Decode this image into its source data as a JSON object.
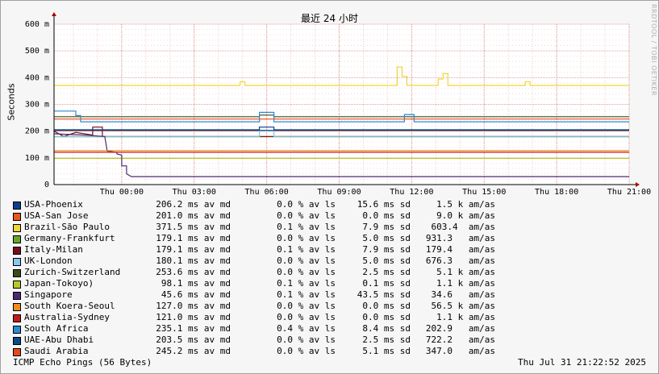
{
  "chart_data": {
    "type": "line",
    "title": "最近 24 小时",
    "ylabel": "Seconds",
    "watermark": "RRDTOOL / TOBI OETIKER",
    "ylim": [
      0,
      600
    ],
    "y_ticks": [
      {
        "v": 0,
        "label": "0"
      },
      {
        "v": 100,
        "label": "100 m"
      },
      {
        "v": 200,
        "label": "200 m"
      },
      {
        "v": 300,
        "label": "300 m"
      },
      {
        "v": 400,
        "label": "400 m"
      },
      {
        "v": 500,
        "label": "500 m"
      },
      {
        "v": 600,
        "label": "600 m"
      }
    ],
    "x_ticks": [
      "Thu 00:00",
      "Thu 03:00",
      "Thu 06:00",
      "Thu 09:00",
      "Thu 12:00",
      "Thu 15:00",
      "Thu 18:00",
      "Thu 21:00"
    ],
    "x_range_hours": [
      -2.8,
      21.0
    ],
    "series": [
      {
        "name": "USA-Phoenix",
        "color": "#0b3e8c",
        "avg": "206.2 ms av md",
        "loss": "0.0 % av ls",
        "sd": "15.6 ms sd",
        "am": "1.5 k am/as",
        "values": [
          [
            -2.8,
            205
          ],
          [
            -0.5,
            205
          ],
          [
            -0.5,
            205
          ],
          [
            5.7,
            205
          ],
          [
            5.7,
            215
          ],
          [
            6.3,
            215
          ],
          [
            6.3,
            205
          ],
          [
            21,
            205
          ]
        ]
      },
      {
        "name": "USA-San Jose",
        "color": "#e8581c",
        "avg": "201.0 ms av md",
        "loss": "0.0 % av ls",
        "sd": "0.0 ms sd",
        "am": "9.0 k am/as",
        "values": [
          [
            -2.8,
            201
          ],
          [
            21,
            201
          ]
        ]
      },
      {
        "name": "Brazil-São Paulo",
        "color": "#f2d634",
        "avg": "371.5 ms av md",
        "loss": "0.1 % av ls",
        "sd": "7.9 ms sd",
        "am": "603.4  am/as",
        "values": [
          [
            -2.8,
            371
          ],
          [
            4.9,
            371
          ],
          [
            4.9,
            385
          ],
          [
            5.1,
            385
          ],
          [
            5.1,
            371
          ],
          [
            11.4,
            371
          ],
          [
            11.4,
            440
          ],
          [
            11.6,
            440
          ],
          [
            11.6,
            405
          ],
          [
            11.8,
            405
          ],
          [
            11.8,
            371
          ],
          [
            13.1,
            371
          ],
          [
            13.1,
            395
          ],
          [
            13.3,
            395
          ],
          [
            13.3,
            415
          ],
          [
            13.5,
            415
          ],
          [
            13.5,
            371
          ],
          [
            16.7,
            371
          ],
          [
            16.7,
            385
          ],
          [
            16.9,
            385
          ],
          [
            16.9,
            371
          ],
          [
            21,
            371
          ]
        ]
      },
      {
        "name": "Germany-Frankfurt",
        "color": "#6aa42a",
        "avg": "179.1 ms av md",
        "loss": "0.0 % av ls",
        "sd": "5.0 ms sd",
        "am": "931.3   am/as",
        "values": [
          [
            -2.8,
            179
          ],
          [
            21,
            179
          ]
        ]
      },
      {
        "name": "Italy-Milan",
        "color": "#7a0a1e",
        "avg": "179.1 ms av md",
        "loss": "0.1 % av ls",
        "sd": "7.9 ms sd",
        "am": "179.4   am/as",
        "values": [
          [
            -2.8,
            200
          ],
          [
            -2.4,
            180
          ],
          [
            -1.9,
            195
          ],
          [
            -1.2,
            185
          ],
          [
            -1.2,
            215
          ],
          [
            -0.8,
            215
          ],
          [
            -0.8,
            180
          ],
          [
            21,
            180
          ]
        ]
      },
      {
        "name": "UK-London",
        "color": "#86c7f0",
        "avg": "180.1 ms av md",
        "loss": "0.0 % av ls",
        "sd": "5.0 ms sd",
        "am": "676.3   am/as",
        "values": [
          [
            -2.8,
            180
          ],
          [
            5.7,
            180
          ],
          [
            5.7,
            200
          ],
          [
            6.3,
            200
          ],
          [
            6.3,
            180
          ],
          [
            21,
            180
          ]
        ]
      },
      {
        "name": "Zurich-Switzerland",
        "color": "#3a4a18",
        "avg": "253.6 ms av md",
        "loss": "0.0 % av ls",
        "sd": "2.5 ms sd",
        "am": "5.1 k am/as",
        "values": [
          [
            -2.8,
            254
          ],
          [
            5.7,
            254
          ],
          [
            5.7,
            260
          ],
          [
            6.3,
            260
          ],
          [
            6.3,
            254
          ],
          [
            21,
            254
          ]
        ]
      },
      {
        "name": "Japan-Tokoyo)",
        "color": "#b5c92a",
        "avg": "98.1 ms av md",
        "loss": "0.1 % av ls",
        "sd": "0.1 ms sd",
        "am": "1.1 k am/as",
        "values": [
          [
            -2.8,
            98
          ],
          [
            21,
            98
          ]
        ]
      },
      {
        "name": "Singapore",
        "color": "#4a2a72",
        "avg": "45.6 ms av md",
        "loss": "0.1 % av ls",
        "sd": "43.5 ms sd",
        "am": "34.6   am/as",
        "values": [
          [
            -2.8,
            190
          ],
          [
            -1.5,
            185
          ],
          [
            -0.7,
            180
          ],
          [
            -0.6,
            125
          ],
          [
            -0.2,
            120
          ],
          [
            -0.2,
            115
          ],
          [
            0.0,
            110
          ],
          [
            0.0,
            70
          ],
          [
            0.2,
            70
          ],
          [
            0.2,
            40
          ],
          [
            0.4,
            30
          ],
          [
            21,
            30
          ]
        ]
      },
      {
        "name": "South Koera-Seoul",
        "color": "#f08c1a",
        "avg": "127.0 ms av md",
        "loss": "0.0 % av ls",
        "sd": "56.5 k am/as",
        "sd_fix": true,
        "am": "56.5 k am/as",
        "values": [
          [
            -2.8,
            127
          ],
          [
            21,
            127
          ]
        ]
      },
      {
        "name": "Australia-Sydney",
        "color": "#c61a1a",
        "avg": "121.0 ms av md",
        "loss": "0.0 % av ls",
        "sd": "0.0 ms sd",
        "am": "1.1 k am/as",
        "values": [
          [
            -2.8,
            121
          ],
          [
            21,
            121
          ]
        ]
      },
      {
        "name": "South Africa",
        "color": "#2a8ad2",
        "avg": "235.1 ms av md",
        "loss": "0.4 % av ls",
        "sd": "8.4 ms sd",
        "am": "202.9   am/as",
        "values": [
          [
            -2.8,
            275
          ],
          [
            -1.9,
            275
          ],
          [
            -1.9,
            258
          ],
          [
            -1.7,
            258
          ],
          [
            -1.7,
            235
          ],
          [
            5.7,
            235
          ],
          [
            5.7,
            270
          ],
          [
            6.3,
            270
          ],
          [
            6.3,
            235
          ],
          [
            11.7,
            235
          ],
          [
            11.7,
            262
          ],
          [
            12.1,
            262
          ],
          [
            12.1,
            235
          ],
          [
            21,
            235
          ]
        ]
      },
      {
        "name": "UAE-Abu Dhabi",
        "color": "#0a4a8a",
        "avg": "203.5 ms av md",
        "loss": "0.0 % av ls",
        "sd": "2.5 ms sd",
        "am": "722.2   am/as",
        "values": [
          [
            -2.8,
            203
          ],
          [
            21,
            203
          ]
        ]
      },
      {
        "name": "Saudi Arabia",
        "color": "#e8481c",
        "avg": "245.2 ms av md",
        "loss": "0.0 % av ls",
        "sd": "5.1 ms sd",
        "am": "347.0   am/as",
        "values": [
          [
            -2.8,
            245
          ],
          [
            21,
            245
          ]
        ]
      }
    ]
  },
  "footer": {
    "left": "ICMP Echo Pings (56 Bytes)",
    "right": "Thu Jul 31 21:22:52 2025"
  }
}
